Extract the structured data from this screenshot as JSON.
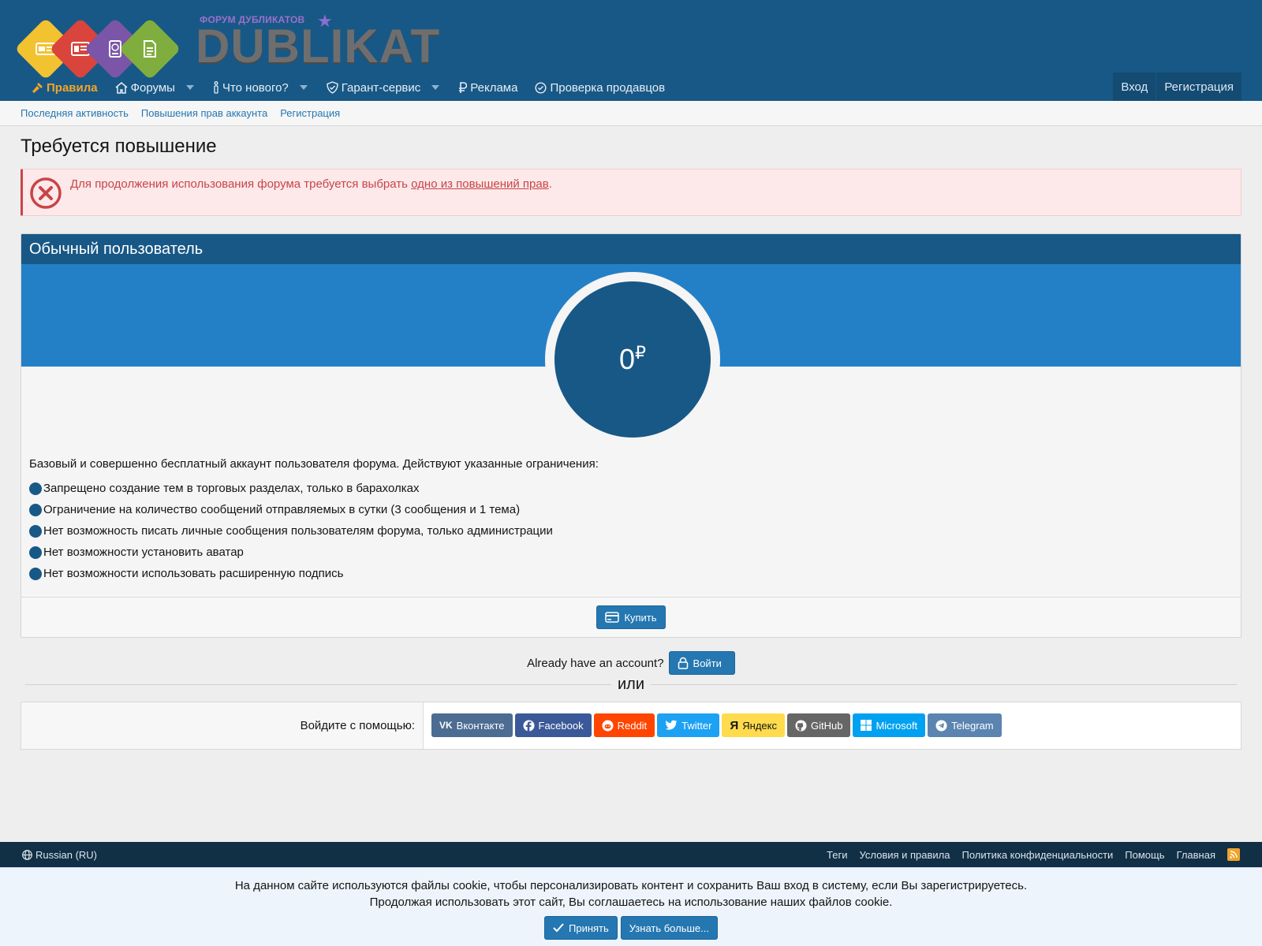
{
  "logo": {
    "tagline": "ФОРУМ ДУБЛИКАТОВ",
    "text": "DUBLIKAT"
  },
  "nav": {
    "items": [
      {
        "label": "Правила",
        "icon": "gavel-icon"
      },
      {
        "label": "Форумы",
        "icon": "home-icon"
      },
      {
        "label": "Что нового?",
        "icon": "info-icon"
      },
      {
        "label": "Гарант-сервис",
        "icon": "shield-check-icon"
      },
      {
        "label": "Реклама",
        "icon": "ruble-icon"
      },
      {
        "label": "Проверка продавцов",
        "icon": "check-circle-icon"
      }
    ],
    "login": "Вход",
    "register": "Регистрация"
  },
  "subnav": {
    "items": [
      "Последняя активность",
      "Повышения прав аккаунта",
      "Регистрация"
    ]
  },
  "page_title": "Требуется повышение",
  "alert": {
    "text": "Для продолжения использования форума требуется выбрать ",
    "link": "одно из повышений прав",
    "suffix": "."
  },
  "card": {
    "title": "Обычный пользователь",
    "price": "0",
    "currency": "₽",
    "description": "Базовый и совершенно бесплатный аккаунт пользователя форума. Действуют указанные ограничения:",
    "features": [
      "Запрещено создание тем в торговых разделах, только в барахолках",
      "Ограничение на количество сообщений отправляемых в сутки (3 сообщения и 1 тема)",
      "Нет возможность писать личные сообщения пользователям форума, только администрации",
      "Нет возможности установить аватар",
      "Нет возможности использовать расширенную подпись"
    ],
    "buy_label": "Купить"
  },
  "account": {
    "question": "Already have an account?",
    "login_label": "Войти"
  },
  "or_text": "или",
  "social": {
    "label": "Войдите с помощью:",
    "buttons": [
      {
        "label": "Вконтакте",
        "color": "#4c6c91"
      },
      {
        "label": "Facebook",
        "color": "#3b5998"
      },
      {
        "label": "Reddit",
        "color": "#ff4500"
      },
      {
        "label": "Twitter",
        "color": "#1da1f2"
      },
      {
        "label": "Яндекс",
        "color": "#ffdb4d"
      },
      {
        "label": "GitHub",
        "color": "#666666"
      },
      {
        "label": "Microsoft",
        "color": "#00a1f1"
      },
      {
        "label": "Telegram",
        "color": "#5b84b1"
      }
    ]
  },
  "footer": {
    "language": "Russian (RU)",
    "links": [
      "Теги",
      "Условия и правила",
      "Политика конфиденциальности",
      "Помощь",
      "Главная"
    ]
  },
  "cookie": {
    "line1": "На данном сайте используются файлы cookie, чтобы персонализировать контент и сохранить Ваш вход в систему, если Вы зарегистрируетесь.",
    "line2": "Продолжая использовать этот сайт, Вы соглашаетесь на использование наших файлов cookie.",
    "accept": "Принять",
    "learn_more": "Узнать больше..."
  },
  "colors": {
    "header": "#185886",
    "accent": "#2577b1",
    "nav_active": "#f5a623",
    "error": "#c84448",
    "band": "#2480c6"
  }
}
